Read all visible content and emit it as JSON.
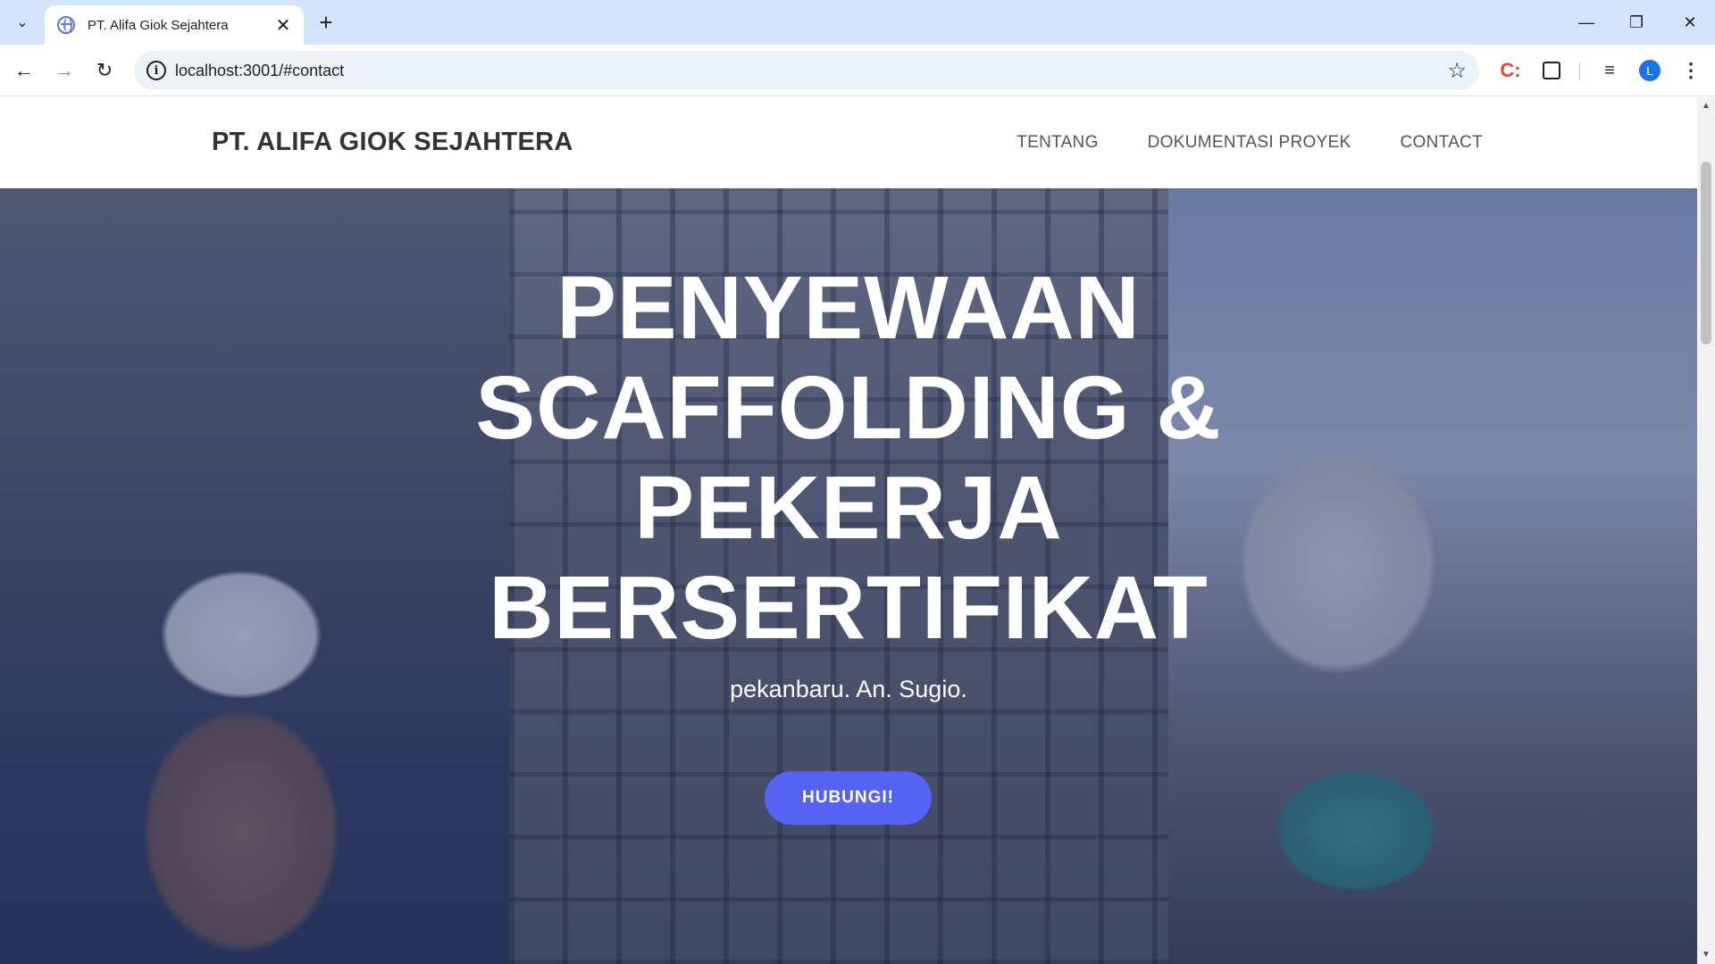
{
  "browser": {
    "tab_title": "PT. Alifa Giok Sejahtera",
    "url": "localhost:3001/#contact",
    "profile_initial": "L",
    "extension_label": "C:",
    "icons": {
      "tab_search": "chevron-down-icon",
      "favicon": "globe-icon",
      "close": "close-icon",
      "new_tab": "plus-icon",
      "minimize": "minimize-icon",
      "restore": "restore-icon",
      "close_window": "close-window-icon",
      "back": "arrow-left-icon",
      "forward": "arrow-right-icon",
      "reload": "reload-icon",
      "info": "info-icon",
      "bookmark": "star-icon",
      "extensions": "puzzle-icon",
      "media": "media-control-icon",
      "menu": "kebab-menu-icon"
    }
  },
  "site": {
    "brand": "PT. ALIFA GIOK SEJAHTERA",
    "nav": [
      {
        "label": "TENTANG"
      },
      {
        "label": "DOKUMENTASI PROYEK"
      },
      {
        "label": "CONTACT"
      }
    ]
  },
  "hero": {
    "title_lines": [
      "PENYEWAAN",
      "SCAFFOLDING &",
      "PEKERJA",
      "BERSERTIFIKAT"
    ],
    "subtitle": "pekanbaru. An. Sugio.",
    "cta_label": "HUBUNGI!"
  },
  "colors": {
    "tabbar": "#d3e3fd",
    "cta": "#5563f5",
    "overlay": "#28376e",
    "brand_text": "#333333"
  }
}
